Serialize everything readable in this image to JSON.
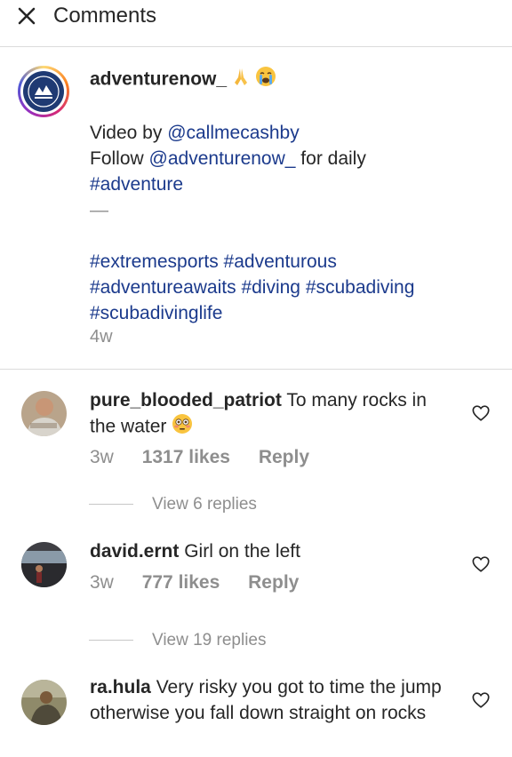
{
  "header": {
    "title": "Comments",
    "close_icon": "close-icon"
  },
  "caption": {
    "username": "adventurenow_",
    "emojis": [
      "folded-hands-emoji",
      "crying-face-emoji"
    ],
    "line1_prefix": "Video by ",
    "line1_mention": "@callmecashby",
    "line2_prefix": "Follow ",
    "line2_mention": "@adventurenow_",
    "line2_suffix": " for daily",
    "line3_tag": "#adventure",
    "separator": "—",
    "tag_line1": "#extremesports #adventurous",
    "tag_line2": "#adventureawaits #diving #scubadiving",
    "tag_line3": "#scubadivinglife",
    "time": "4w"
  },
  "comments": [
    {
      "username": "pure_blooded_patriot",
      "text": "To many rocks in the water",
      "emoji": "flushed-face-emoji",
      "time": "3w",
      "likes": "1317 likes",
      "reply": "Reply",
      "view_replies": "View 6 replies"
    },
    {
      "username": "david.ernt",
      "text": "Girl on the left",
      "time": "3w",
      "likes": "777 likes",
      "reply": "Reply",
      "view_replies": "View 19 replies"
    },
    {
      "username": "ra.hula",
      "text": "Very risky you got to time the jump otherwise you fall down straight on rocks"
    }
  ],
  "colors": {
    "link": "#1b3a8c",
    "muted": "#8e8e8e",
    "divider": "#dbdbdb",
    "text": "#262626"
  }
}
